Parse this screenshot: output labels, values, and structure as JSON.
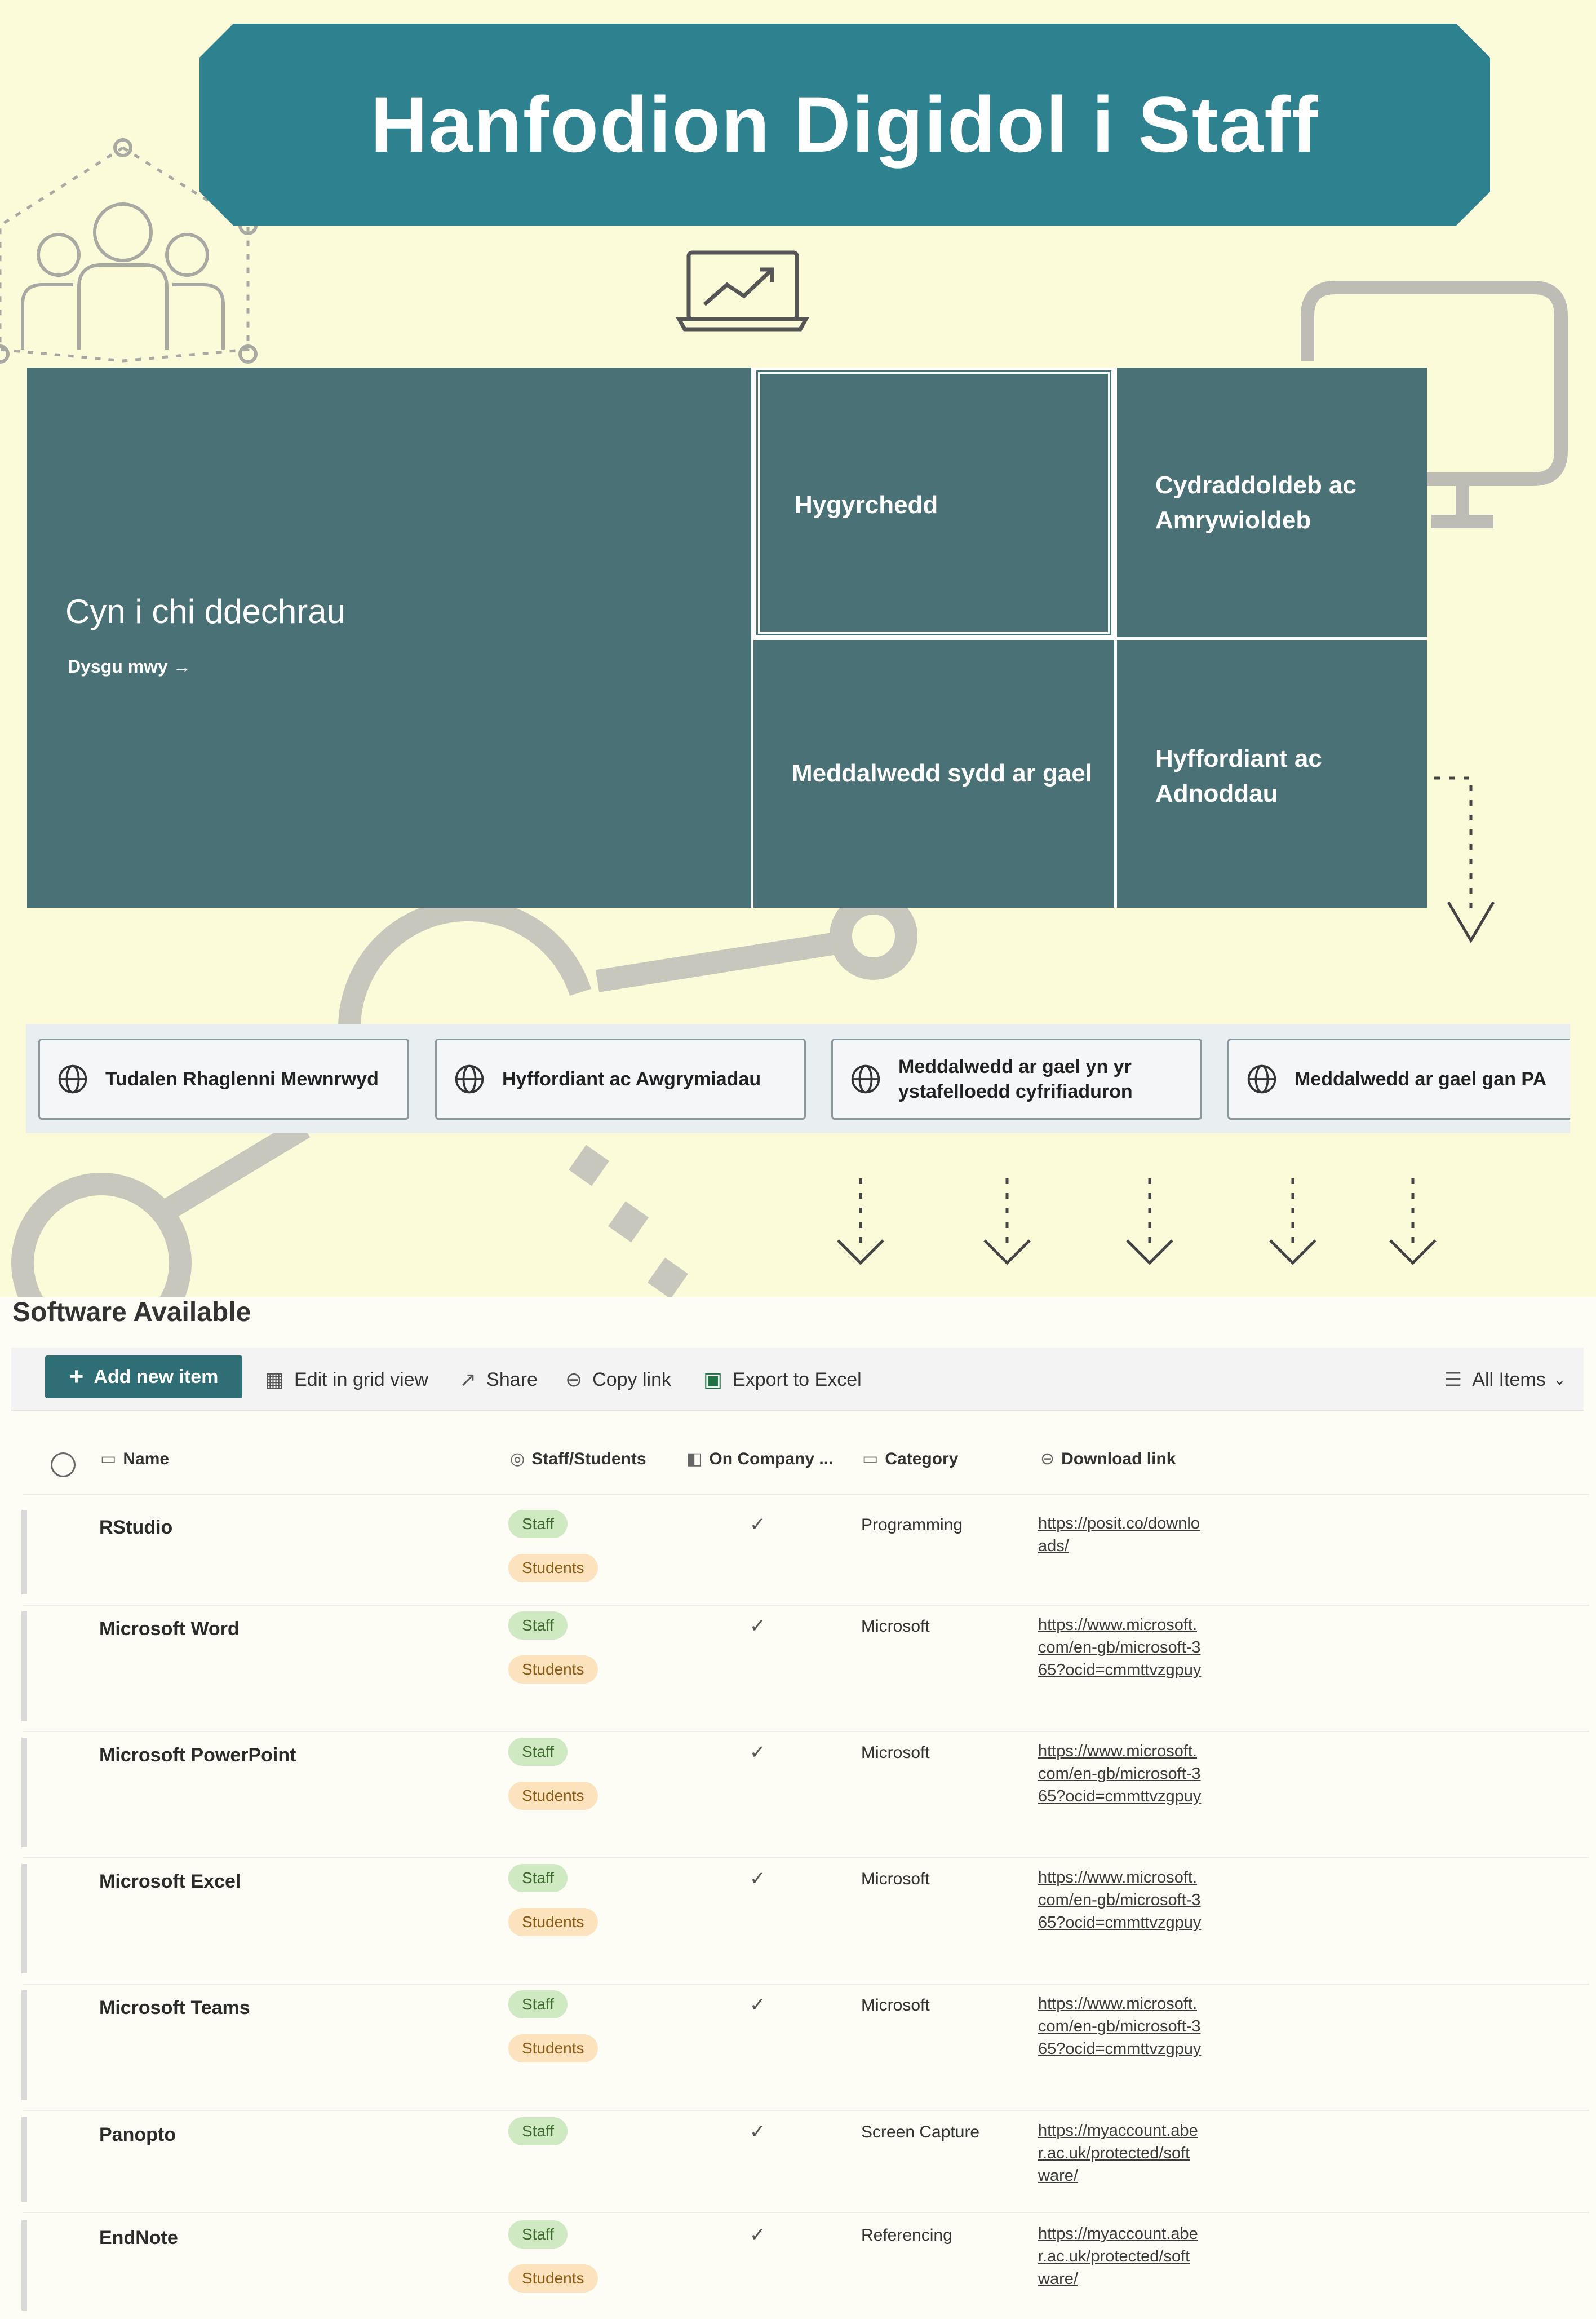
{
  "banner": {
    "title": "Hanfodion Digidol i Staff"
  },
  "hero": {
    "main": {
      "title": "Cyn i chi ddechrau",
      "link": "Dysgu mwy →"
    },
    "tiles": [
      "Hygyrchedd",
      "Cydraddoldeb ac Amrywioldeb",
      "Meddalwedd sydd ar gael",
      "Hyffordiant ac Adnoddau"
    ]
  },
  "quick_links": [
    "Tudalen Rhaglenni Mewnrwyd",
    "Hyffordiant ac Awgrymiadau",
    "Meddalwedd ar gael yn yr ystafelloedd cyfrifiaduron",
    "Meddalwedd ar gael gan PA"
  ],
  "list": {
    "title": "Software Available",
    "commands": {
      "add": "Add new item",
      "edit": "Edit in grid view",
      "share": "Share",
      "copy": "Copy link",
      "export": "Export to Excel",
      "view": "All Items"
    },
    "columns": [
      "Name",
      "Staff/Students",
      "On Company ...",
      "Category",
      "Download link"
    ],
    "rows": [
      {
        "name": "RStudio",
        "staff": "Staff",
        "students": "Students",
        "category": "Programming",
        "link": "https://posit.co/downloads/"
      },
      {
        "name": "Microsoft Word",
        "staff": "Staff",
        "students": "Students",
        "category": "Microsoft",
        "link": "https://www.microsoft.com/en-gb/microsoft-365?ocid=cmmttvzgpuy"
      },
      {
        "name": "Microsoft PowerPoint",
        "staff": "Staff",
        "students": "Students",
        "category": "Microsoft",
        "link": "https://www.microsoft.com/en-gb/microsoft-365?ocid=cmmttvzgpuy"
      },
      {
        "name": "Microsoft Excel",
        "staff": "Staff",
        "students": "Students",
        "category": "Microsoft",
        "link": "https://www.microsoft.com/en-gb/microsoft-365?ocid=cmmttvzgpuy"
      },
      {
        "name": "Microsoft Teams",
        "staff": "Staff",
        "students": "Students",
        "category": "Microsoft",
        "link": "https://www.microsoft.com/en-gb/microsoft-365?ocid=cmmttvzgpuy"
      },
      {
        "name": "Panopto",
        "staff": "Staff",
        "students": "",
        "category": "Screen Capture",
        "link": "https://myaccount.aber.ac.uk/protected/software/"
      },
      {
        "name": "EndNote",
        "staff": "Staff",
        "students": "Students",
        "category": "Referencing",
        "link": "https://myaccount.aber.ac.uk/protected/software/"
      }
    ]
  },
  "colors": {
    "banner": "#2e8290",
    "tile": "#4a7276",
    "background": "#fbfbd9",
    "accent_button": "#2e6e74"
  }
}
